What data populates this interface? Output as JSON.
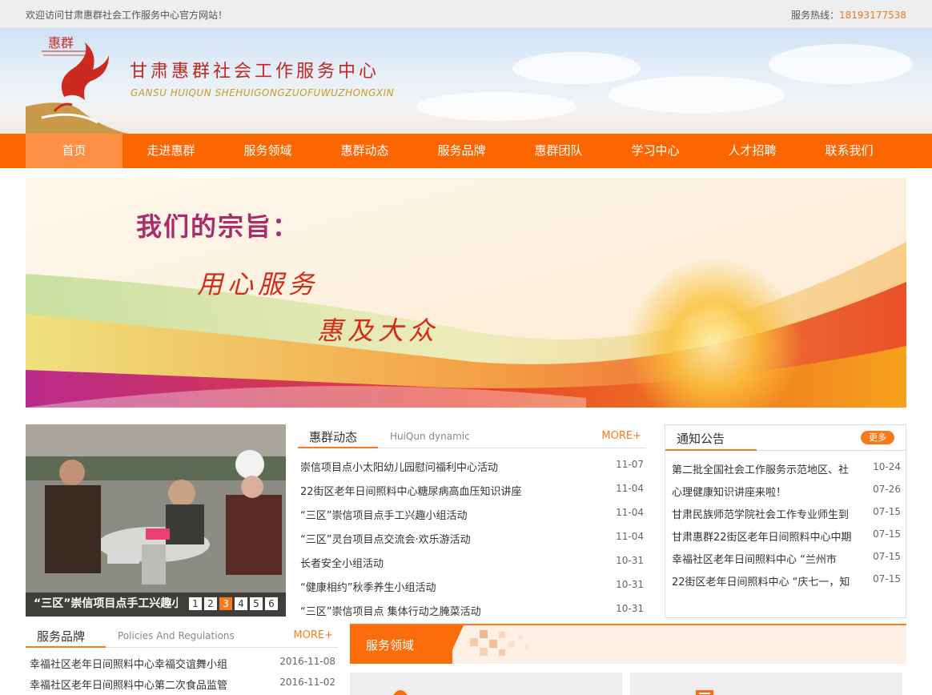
{
  "topbar": {
    "welcome": "欢迎访问甘肃惠群社会工作服务中心官方网站！",
    "hotline_label": "服务热线：",
    "hotline_number": "18193177538"
  },
  "header": {
    "logo_badge": "惠群",
    "name_cn": "甘肃惠群社会工作服务中心",
    "name_en": "GANSU HUIQUN SHEHUIGONGZUOFUWUZHONGXIN"
  },
  "nav": {
    "items": [
      "首页",
      "走进惠群",
      "服务领域",
      "惠群动态",
      "服务品牌",
      "惠群团队",
      "学习中心",
      "人才招聘",
      "联系我们"
    ],
    "active_index": 0
  },
  "banner": {
    "title": "我们的宗旨：",
    "line1": "用心服务",
    "line2": "惠及大众"
  },
  "slider": {
    "caption": "“三区”崇信项目点手工兴趣小组活动",
    "pages": [
      "1",
      "2",
      "3",
      "4",
      "5",
      "6"
    ],
    "current": 3
  },
  "news": {
    "title": "惠群动态",
    "subtitle": "HuiQun dynamic",
    "more": "MORE+",
    "items": [
      {
        "title": "崇信项目点小太阳幼儿园慰问福利中心活动",
        "date": "11-07"
      },
      {
        "title": "22街区老年日间照料中心糖尿病高血压知识讲座",
        "date": "11-04"
      },
      {
        "title": "“三区”崇信项目点手工兴趣小组活动",
        "date": "11-04"
      },
      {
        "title": "“三区”灵台项目点交流会·欢乐游活动",
        "date": "11-04"
      },
      {
        "title": "长者安全小组活动",
        "date": "10-31"
      },
      {
        "title": "“健康相约”秋季养生小组活动",
        "date": "10-31"
      },
      {
        "title": "“三区”崇信项目点 集体行动之腌菜活动",
        "date": "10-31"
      }
    ]
  },
  "notice": {
    "title": "通知公告",
    "more": "更多",
    "items": [
      {
        "title": "第二批全国社会工作服务示范地区、社",
        "date": "10-24"
      },
      {
        "title": "心理健康知识讲座来啦！",
        "date": "07-26"
      },
      {
        "title": "甘肃民族师范学院社会工作专业师生到",
        "date": "07-15"
      },
      {
        "title": "甘肃惠群22街区老年日间照料中心中期",
        "date": "07-15"
      },
      {
        "title": "幸福社区老年日间照料中心 “兰州市",
        "date": "07-15"
      },
      {
        "title": "22街区老年日间照料中心 “庆七一，知",
        "date": "07-15"
      }
    ]
  },
  "brand": {
    "title": "服务品牌",
    "subtitle": "Policies And Regulations",
    "more": "MORE+",
    "items": [
      {
        "title": "幸福社区老年日间照料中心幸福交谊舞小组",
        "date": "2016-11-08"
      },
      {
        "title": "幸福社区老年日间照料中心第二次食品监管",
        "date": "2016-11-02"
      }
    ]
  },
  "domain": {
    "title": "服务领域"
  },
  "colors": {
    "accent": "#fb6600",
    "nav_active": "#fd8f45",
    "brand_red": "#c0281f",
    "hotline": "#f0791c"
  }
}
